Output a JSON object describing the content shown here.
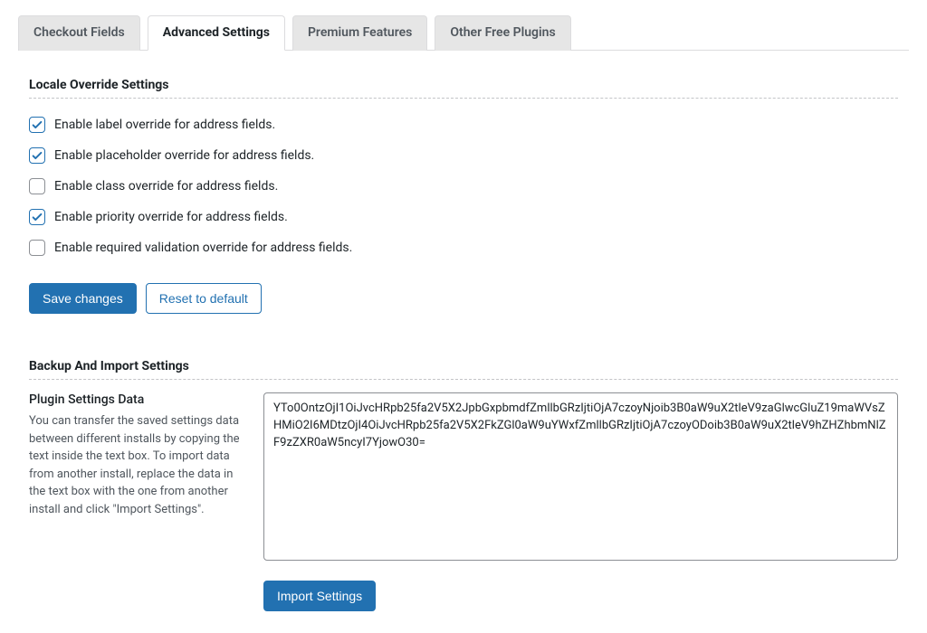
{
  "tabs": [
    {
      "label": "Checkout Fields",
      "active": false
    },
    {
      "label": "Advanced Settings",
      "active": true
    },
    {
      "label": "Premium Features",
      "active": false
    },
    {
      "label": "Other Free Plugins",
      "active": false
    }
  ],
  "locale_override": {
    "title": "Locale Override Settings",
    "options": [
      {
        "label": "Enable label override for address fields.",
        "checked": true
      },
      {
        "label": "Enable placeholder override for address fields.",
        "checked": true
      },
      {
        "label": "Enable class override for address fields.",
        "checked": false
      },
      {
        "label": "Enable priority override for address fields.",
        "checked": true
      },
      {
        "label": "Enable required validation override for address fields.",
        "checked": false
      }
    ]
  },
  "buttons": {
    "save": "Save changes",
    "reset": "Reset to default",
    "import": "Import Settings"
  },
  "backup": {
    "title": "Backup And Import Settings",
    "subtitle": "Plugin Settings Data",
    "description": "You can transfer the saved settings data between different installs by copying the text inside the text box. To import data from another install, replace the data in the text box with the one from another install and click \"Import Settings\".",
    "data": "YTo0OntzOjI1OiJvcHRpb25fa2V5X2JpbGxpbmdfZmllbGRzIjtiOjA7czoyNjoib3B0aW9uX2tleV9zaGlwcGluZ19maWVsZHMiO2I6MDtzOjI4OiJvcHRpb25fa2V5X2FkZGl0aW9uYWxfZmllbGRzIjtiOjA7czoyODoib3B0aW9uX2tleV9hZHZhbmNlZF9zZXR0aW5ncyI7YjowO30="
  }
}
